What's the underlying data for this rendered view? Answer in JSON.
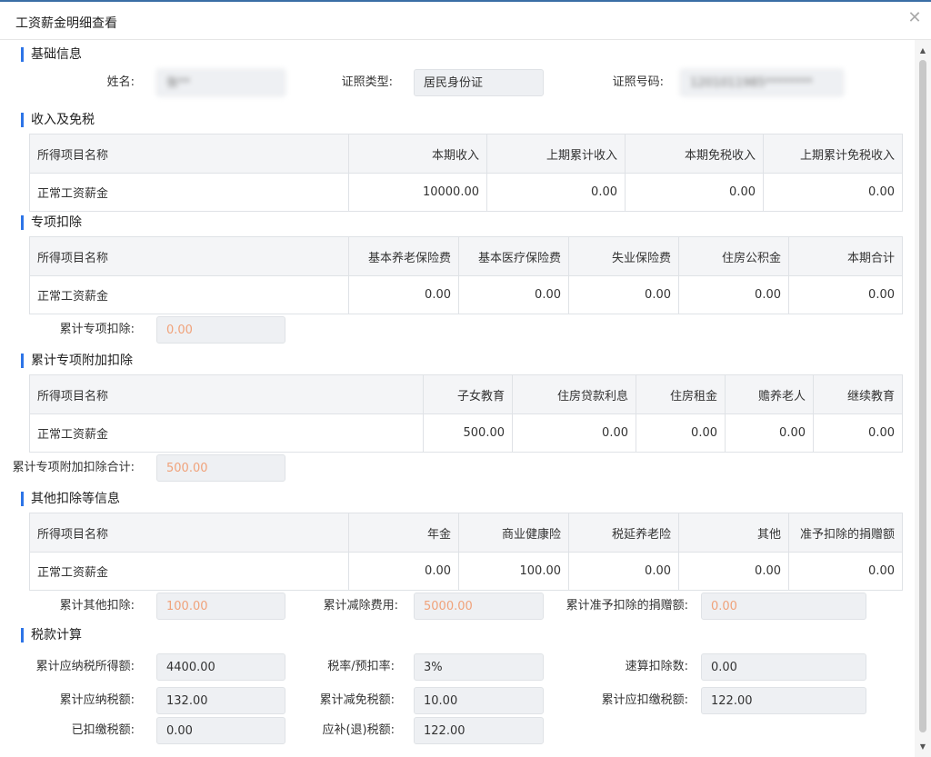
{
  "dialog": {
    "title": "工资薪金明细查看"
  },
  "basic": {
    "section": "基础信息",
    "name_label": "姓名:",
    "name_value": "张**",
    "idtype_label": "证照类型:",
    "idtype_value": "居民身份证",
    "idno_label": "证照号码:",
    "idno_value": "1201011985********"
  },
  "income": {
    "section": "收入及免税",
    "headers": [
      "所得项目名称",
      "本期收入",
      "上期累计收入",
      "本期免税收入",
      "上期累计免税收入"
    ],
    "row": [
      "正常工资薪金",
      "10000.00",
      "0.00",
      "0.00",
      "0.00"
    ]
  },
  "special": {
    "section": "专项扣除",
    "headers": [
      "所得项目名称",
      "基本养老保险费",
      "基本医疗保险费",
      "失业保险费",
      "住房公积金",
      "本期合计"
    ],
    "row": [
      "正常工资薪金",
      "0.00",
      "0.00",
      "0.00",
      "0.00",
      "0.00"
    ],
    "total_label": "累计专项扣除:",
    "total_value": "0.00"
  },
  "additional": {
    "section": "累计专项附加扣除",
    "headers": [
      "所得项目名称",
      "子女教育",
      "住房贷款利息",
      "住房租金",
      "赡养老人",
      "继续教育"
    ],
    "row": [
      "正常工资薪金",
      "500.00",
      "0.00",
      "0.00",
      "0.00",
      "0.00"
    ],
    "total_label": "累计专项附加扣除合计:",
    "total_value": "500.00"
  },
  "other": {
    "section": "其他扣除等信息",
    "headers": [
      "所得项目名称",
      "年金",
      "商业健康险",
      "税延养老险",
      "其他",
      "准予扣除的捐赠额"
    ],
    "row": [
      "正常工资薪金",
      "0.00",
      "100.00",
      "0.00",
      "0.00",
      "0.00"
    ],
    "other_label": "累计其他扣除:",
    "other_value": "100.00",
    "reduce_label": "累计减除费用:",
    "reduce_value": "5000.00",
    "donate_label": "累计准予扣除的捐赠额:",
    "donate_value": "0.00"
  },
  "tax": {
    "section": "税款计算",
    "taxable_label": "累计应纳税所得额:",
    "taxable_value": "4400.00",
    "rate_label": "税率/预扣率:",
    "rate_value": "3%",
    "quick_label": "速算扣除数:",
    "quick_value": "0.00",
    "payable_label": "累计应纳税额:",
    "payable_value": "132.00",
    "exempt_label": "累计减免税额:",
    "exempt_value": "10.00",
    "withhold_label": "累计应扣缴税额:",
    "withhold_value": "122.00",
    "paid_label": "已扣缴税额:",
    "paid_value": "0.00",
    "refund_label": "应补(退)税额:",
    "refund_value": "122.00"
  }
}
